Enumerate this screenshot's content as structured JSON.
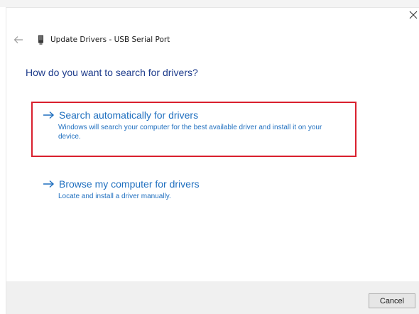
{
  "window": {
    "title": "Update Drivers - USB Serial Port"
  },
  "main": {
    "heading": "How do you want to search for drivers?",
    "options": [
      {
        "title": "Search automatically for drivers",
        "description": "Windows will search your computer for the best available driver and install it on your device.",
        "highlighted": true
      },
      {
        "title": "Browse my computer for drivers",
        "description": "Locate and install a driver manually.",
        "highlighted": false
      }
    ]
  },
  "footer": {
    "cancel_label": "Cancel"
  },
  "icons": {
    "close": "close-icon",
    "back": "back-arrow-icon",
    "device": "usb-device-icon",
    "option_arrow": "right-arrow-icon"
  },
  "colors": {
    "heading": "#1e3c8c",
    "link": "#1f6fbf",
    "highlight_border": "#d9202e",
    "footer_bg": "#f0f0f0"
  }
}
